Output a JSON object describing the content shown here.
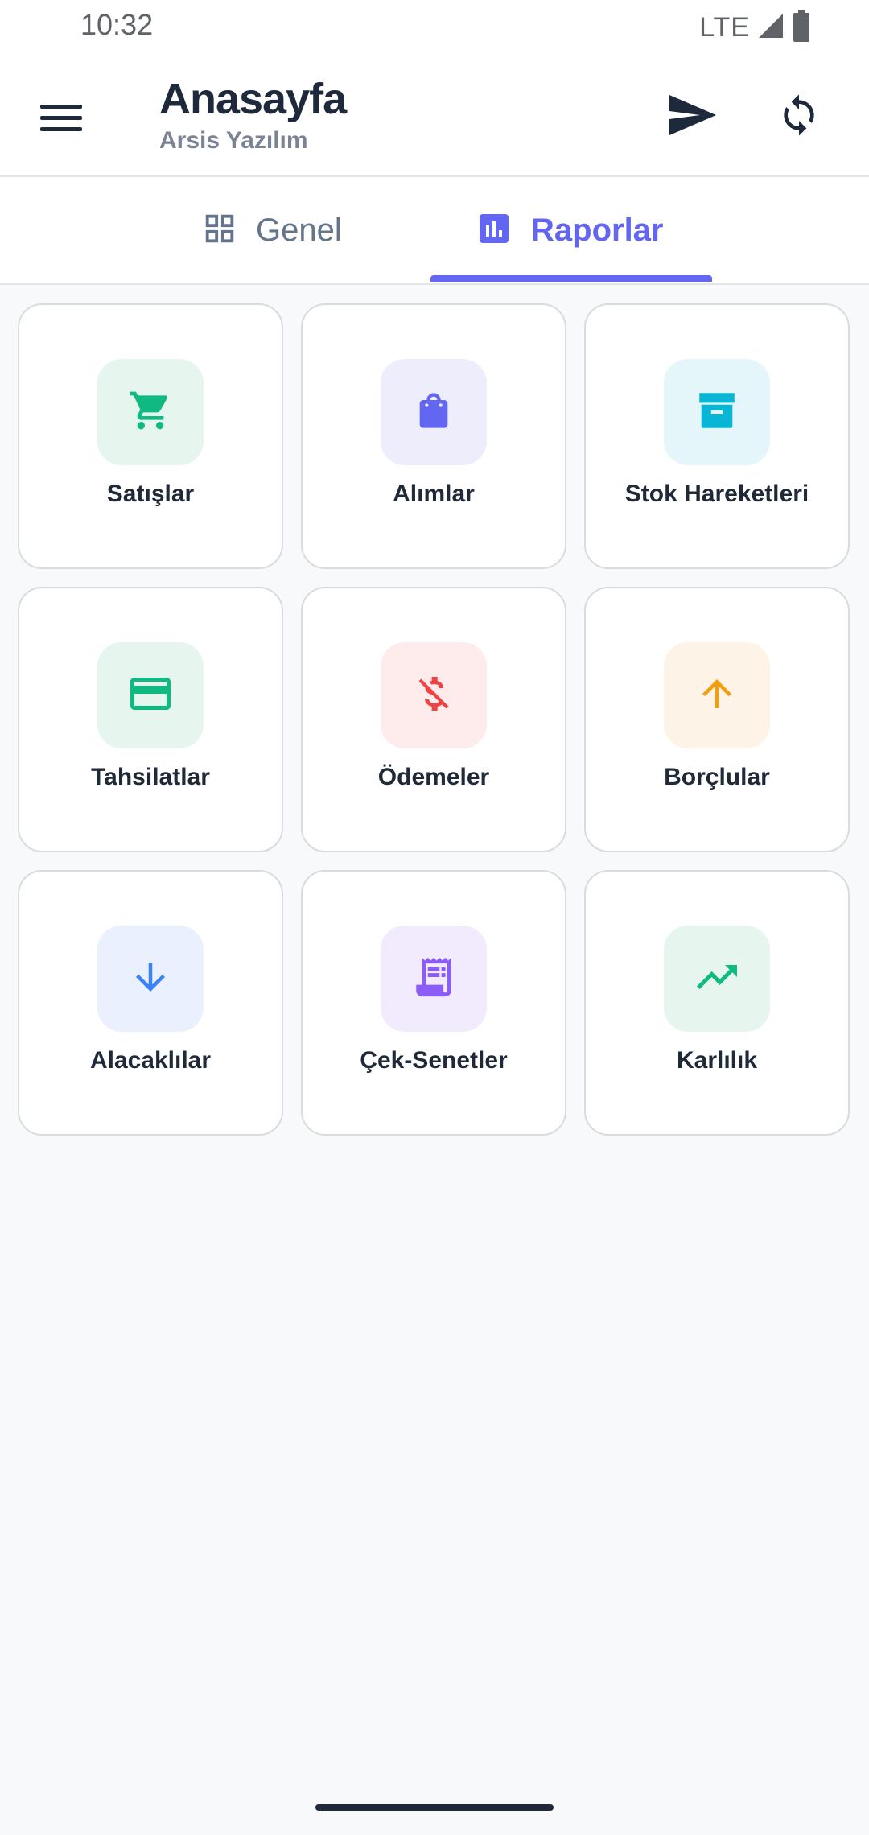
{
  "status_bar": {
    "time": "10:32",
    "network": "LTE"
  },
  "app_bar": {
    "title": "Anasayfa",
    "subtitle": "Arsis Yazılım"
  },
  "tabs": [
    {
      "label": "Genel",
      "icon": "grid-icon",
      "selected": false
    },
    {
      "label": "Raporlar",
      "icon": "bar-chart-icon",
      "selected": true
    }
  ],
  "colors": {
    "accent": "#6366f1",
    "title": "#1e293b",
    "subtitle": "#7b8494"
  },
  "cards": [
    {
      "label": "Satışlar",
      "icon": "shopping-cart-icon",
      "color": "#10b981",
      "bg": "#e6f6ef"
    },
    {
      "label": "Alımlar",
      "icon": "shopping-bag-icon",
      "color": "#6366f1",
      "bg": "#eeedfc"
    },
    {
      "label": "Stok Hareketleri",
      "icon": "archive-box-icon",
      "color": "#06b6d4",
      "bg": "#e4f6fa"
    },
    {
      "label": "Tahsilatlar",
      "icon": "credit-card-icon",
      "color": "#10b981",
      "bg": "#e6f6ef"
    },
    {
      "label": "Ödemeler",
      "icon": "money-off-icon",
      "color": "#ef4444",
      "bg": "#fdeceb"
    },
    {
      "label": "Borçlular",
      "icon": "arrow-up-icon",
      "color": "#f59e0b",
      "bg": "#fdf3e6"
    },
    {
      "label": "Alacaklılar",
      "icon": "arrow-down-icon",
      "color": "#3b82f6",
      "bg": "#eaf0fd"
    },
    {
      "label": "Çek-Senetler",
      "icon": "receipt-icon",
      "color": "#8b5cf6",
      "bg": "#f1ebfd"
    },
    {
      "label": "Karlılık",
      "icon": "trending-up-icon",
      "color": "#10b981",
      "bg": "#e6f6ef"
    }
  ]
}
